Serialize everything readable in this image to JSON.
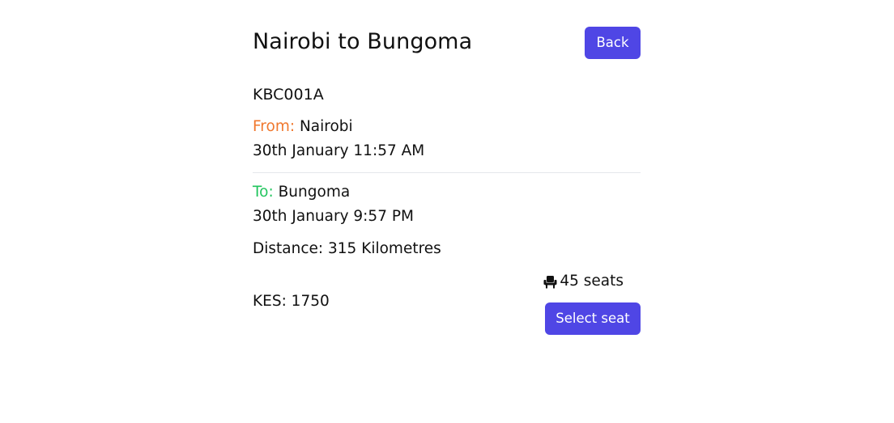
{
  "trip": {
    "title": "Nairobi to Bungoma",
    "back_label": "Back",
    "registration": "KBC001A",
    "from": {
      "label": "From:",
      "city": "Nairobi",
      "datetime": "30th January 11:57 AM"
    },
    "to": {
      "label": "To:",
      "city": "Bungoma",
      "datetime": "30th January 9:57 PM"
    },
    "distance": "Distance: 315 Kilometres",
    "price": "KES: 1750",
    "seats": "45 seats",
    "select_seat_label": "Select seat",
    "icons": {
      "seat": "seat-icon"
    },
    "colors": {
      "accent": "#4f46e5",
      "from_label": "#f0782e",
      "to_label": "#22c55e"
    }
  }
}
